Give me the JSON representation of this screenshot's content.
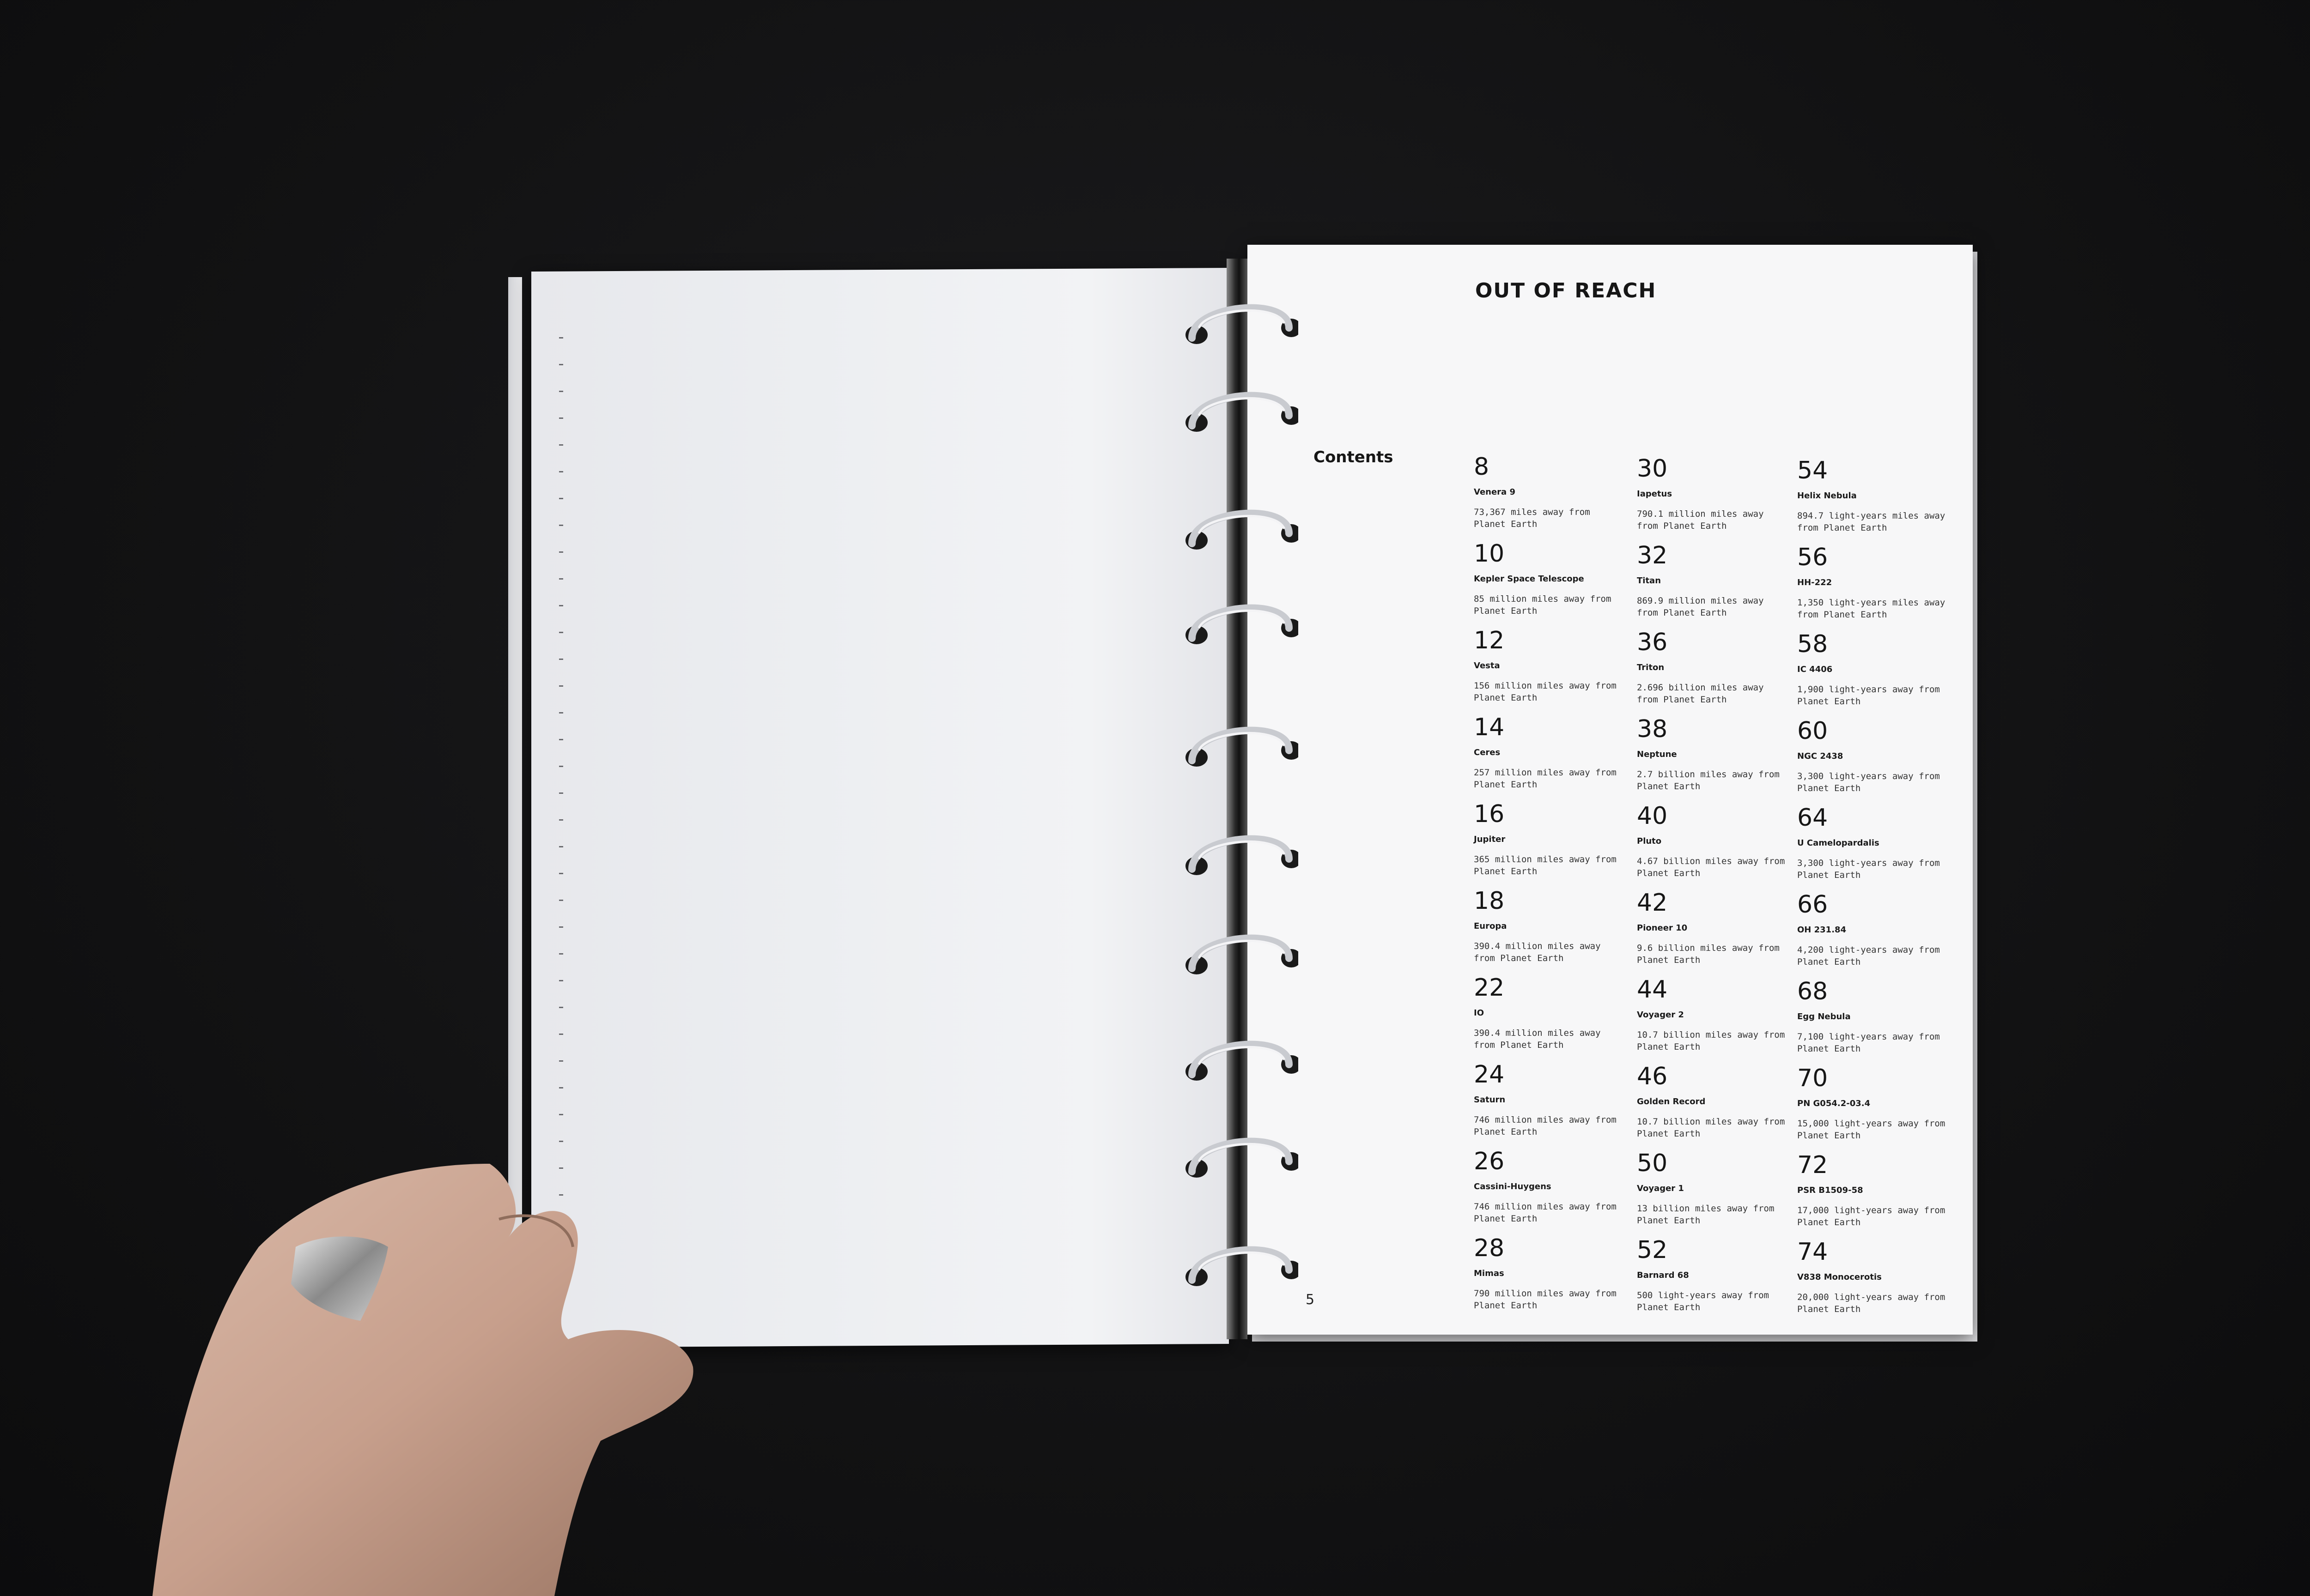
{
  "book": {
    "title": "OUT OF REACH",
    "contents_label": "Contents",
    "page_number": "5"
  },
  "contents": [
    {
      "page": "8",
      "name": "Venera 9",
      "distance": "73,367 miles away from Planet Earth"
    },
    {
      "page": "10",
      "name": "Kepler Space Telescope",
      "distance": "85 million miles away from Planet Earth"
    },
    {
      "page": "12",
      "name": "Vesta",
      "distance": "156 million miles away from Planet Earth"
    },
    {
      "page": "14",
      "name": "Ceres",
      "distance": "257 million miles away from Planet Earth"
    },
    {
      "page": "16",
      "name": "Jupiter",
      "distance": "365 million miles away from Planet Earth"
    },
    {
      "page": "18",
      "name": "Europa",
      "distance": "390.4 million miles away from Planet Earth"
    },
    {
      "page": "22",
      "name": "IO",
      "distance": "390.4 million miles away from Planet Earth"
    },
    {
      "page": "24",
      "name": "Saturn",
      "distance": "746 million miles away from Planet Earth"
    },
    {
      "page": "26",
      "name": "Cassini-Huygens",
      "distance": "746 million miles away from Planet Earth"
    },
    {
      "page": "28",
      "name": "Mimas",
      "distance": "790 million miles away from Planet Earth"
    },
    {
      "page": "30",
      "name": "Iapetus",
      "distance": "790.1 million miles away from Planet Earth"
    },
    {
      "page": "32",
      "name": "Titan",
      "distance": "869.9 million miles away from Planet Earth"
    },
    {
      "page": "36",
      "name": "Triton",
      "distance": "2.696 billion miles away from Planet Earth"
    },
    {
      "page": "38",
      "name": "Neptune",
      "distance": "2.7 billion miles away from Planet Earth"
    },
    {
      "page": "40",
      "name": "Pluto",
      "distance": "4.67 billion miles away from Planet Earth"
    },
    {
      "page": "42",
      "name": "Pioneer 10",
      "distance": "9.6 billion miles away from Planet Earth"
    },
    {
      "page": "44",
      "name": "Voyager 2",
      "distance": "10.7 billion miles away from Planet Earth"
    },
    {
      "page": "46",
      "name": "Golden Record",
      "distance": "10.7 billion miles away from Planet Earth"
    },
    {
      "page": "50",
      "name": "Voyager 1",
      "distance": "13 billion miles away from Planet Earth"
    },
    {
      "page": "52",
      "name": "Barnard 68",
      "distance": "500 light-years away from Planet Earth"
    },
    {
      "page": "54",
      "name": "Helix Nebula",
      "distance": "894.7 light-years miles away from Planet Earth"
    },
    {
      "page": "56",
      "name": "HH-222",
      "distance": "1,350 light-years miles away from Planet Earth"
    },
    {
      "page": "58",
      "name": "IC 4406",
      "distance": "1,900 light-years away from Planet Earth"
    },
    {
      "page": "60",
      "name": "NGC 2438",
      "distance": "3,300 light-years away from Planet Earth"
    },
    {
      "page": "64",
      "name": "U Camelopardalis",
      "distance": "3,300 light-years away from Planet Earth"
    },
    {
      "page": "66",
      "name": "OH 231.84",
      "distance": "4,200 light-years away from Planet Earth"
    },
    {
      "page": "68",
      "name": "Egg Nebula",
      "distance": "7,100 light-years away from Planet Earth"
    },
    {
      "page": "70",
      "name": "PN G054.2-03.4",
      "distance": "15,000 light-years away from Planet Earth"
    },
    {
      "page": "72",
      "name": "PSR B1509-58",
      "distance": "17,000 light-years away from Planet Earth"
    },
    {
      "page": "74",
      "name": "V838 Monocerotis",
      "distance": "20,000 light-years away from Planet Earth"
    }
  ],
  "colors": {
    "background": "#121213",
    "page": "#f7f7f8",
    "ink": "#161616",
    "ring": "#c9cbd0"
  }
}
